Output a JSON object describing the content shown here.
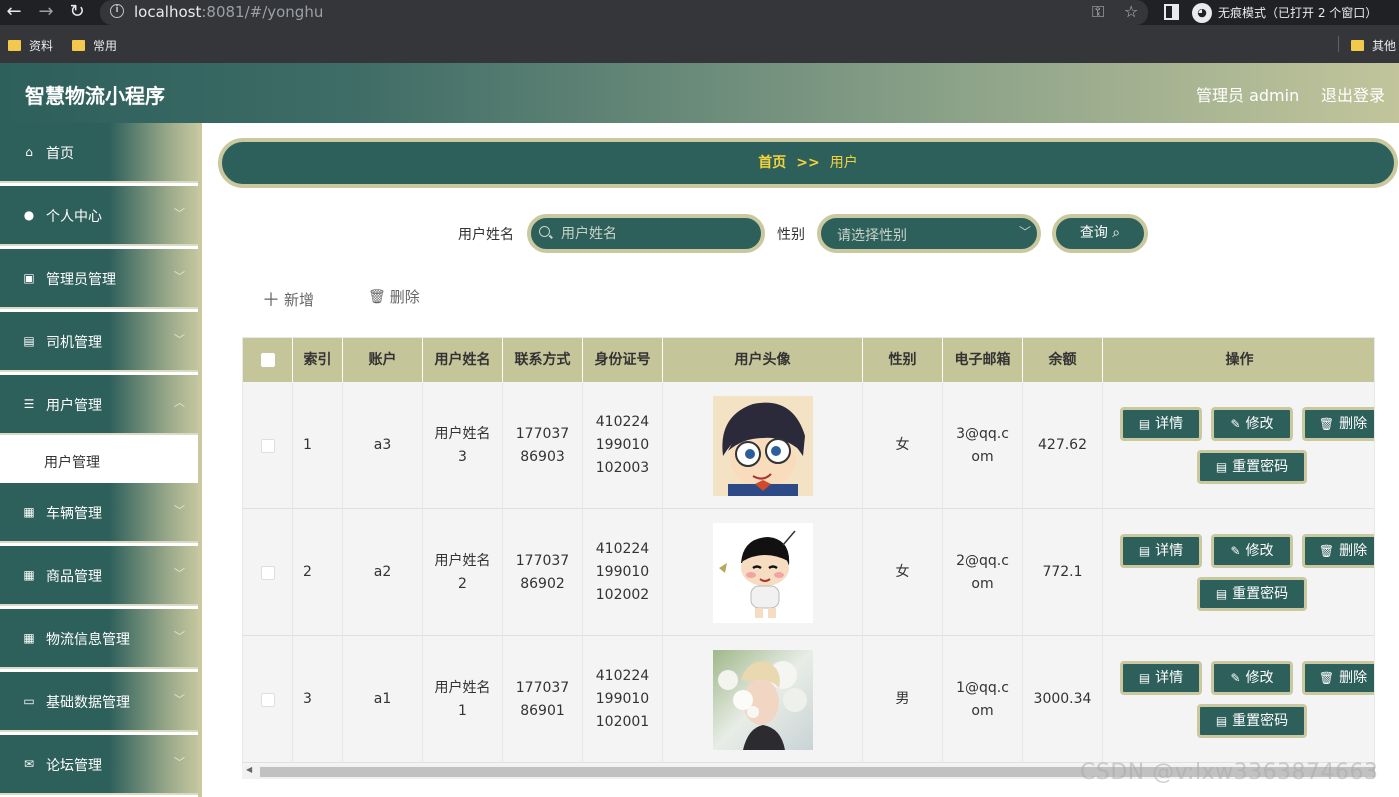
{
  "browser": {
    "url_host": "localhost",
    "url_rest": ":8081/#/yonghu",
    "incognito_label": "无痕模式（已打开 2 个窗口）",
    "bookmarks": [
      "资料",
      "常用"
    ],
    "other_bookmarks": "其他"
  },
  "header": {
    "title": "智慧物流小程序",
    "admin_label": "管理员 admin",
    "logout_label": "退出登录"
  },
  "sidebar": {
    "items": [
      {
        "label": "首页",
        "icon": "home-icon"
      },
      {
        "label": "个人中心",
        "icon": "user-icon"
      },
      {
        "label": "管理员管理",
        "icon": "briefcase-icon"
      },
      {
        "label": "司机管理",
        "icon": "clipboard-icon"
      },
      {
        "label": "用户管理",
        "icon": "sliders-icon"
      },
      {
        "label": "车辆管理",
        "icon": "grid-icon"
      },
      {
        "label": "商品管理",
        "icon": "grid-icon"
      },
      {
        "label": "物流信息管理",
        "icon": "grid-icon"
      },
      {
        "label": "基础数据管理",
        "icon": "monitor-icon"
      },
      {
        "label": "论坛管理",
        "icon": "message-icon"
      }
    ],
    "sub_item": "用户管理"
  },
  "breadcrumb": {
    "home": "首页",
    "separator": ">>",
    "current": "用户"
  },
  "search": {
    "name_label": "用户姓名",
    "name_placeholder": "用户姓名",
    "gender_label": "性别",
    "gender_placeholder": "请选择性别",
    "query_label": "查询"
  },
  "actions": {
    "add_label": "新增",
    "delete_label": "删除"
  },
  "table": {
    "headers": [
      "索引",
      "账户",
      "用户姓名",
      "联系方式",
      "身份证号",
      "用户头像",
      "性别",
      "电子邮箱",
      "余额",
      "操作"
    ],
    "rows": [
      {
        "index": "1",
        "account": "a3",
        "name": "用户姓名3",
        "phone": "17703786903",
        "id_card": "410224199010102003",
        "gender": "女",
        "email": "3@qq.com",
        "balance": "427.62"
      },
      {
        "index": "2",
        "account": "a2",
        "name": "用户姓名2",
        "phone": "17703786902",
        "id_card": "410224199010102002",
        "gender": "女",
        "email": "2@qq.com",
        "balance": "772.1"
      },
      {
        "index": "3",
        "account": "a1",
        "name": "用户姓名1",
        "phone": "17703786901",
        "id_card": "410224199010102001",
        "gender": "男",
        "email": "1@qq.com",
        "balance": "3000.34"
      }
    ],
    "ops": {
      "detail": "详情",
      "edit": "修改",
      "delete": "删除",
      "reset": "重置密码"
    }
  },
  "watermark": "CSDN @v:lxw3363874663",
  "colors": {
    "primary": "#2d5f5b",
    "accent": "#c9c89f",
    "breadcrumb_text": "#f5d33b",
    "table_header": "#c5c59a"
  }
}
